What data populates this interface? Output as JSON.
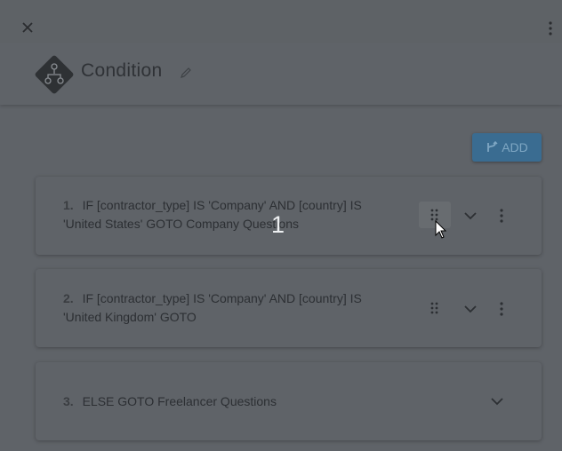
{
  "dialog": {
    "title": "Condition",
    "add_label": "ADD"
  },
  "conditions": [
    {
      "number": "1.",
      "text": "IF [contractor_type] IS 'Company' AND [country] IS",
      "text2": "'United States' GOTO Company Questions"
    },
    {
      "number": "2.",
      "text": "IF [contractor_type] IS 'Company' AND [country] IS",
      "text2": "'United Kingdom' GOTO"
    },
    {
      "number": "3.",
      "text": "ELSE GOTO Freelancer Questions"
    }
  ],
  "overlay": {
    "step_number": "1"
  },
  "colors": {
    "accent": "#3a6c91",
    "overlay_bg": "#5f6368"
  },
  "icons": [
    "close-icon",
    "more-vert-icon",
    "condition-logo-icon",
    "edit-pencil-icon",
    "fork-icon",
    "drag-handle-icon",
    "chevron-down-icon",
    "mouse-cursor-icon"
  ]
}
